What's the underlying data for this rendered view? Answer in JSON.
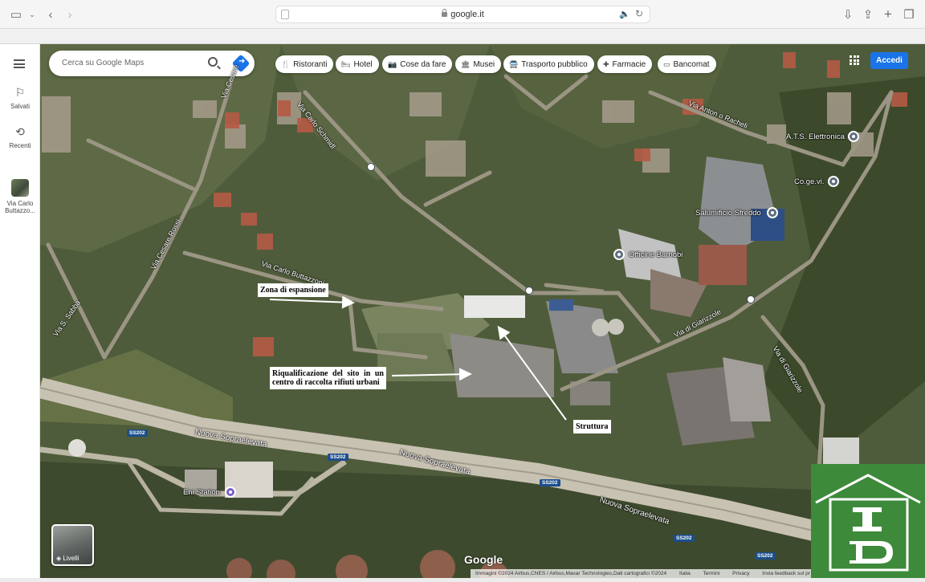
{
  "browser": {
    "url": "google.it"
  },
  "sidebar": {
    "items": [
      {
        "label": "Salvati",
        "icon": "bookmark-icon"
      },
      {
        "label": "Recenti",
        "icon": "history-icon"
      },
      {
        "label": "Via Carlo Buttazzo...",
        "icon": "place-thumbnail"
      }
    ]
  },
  "search": {
    "placeholder": "Cerca su Google Maps"
  },
  "chips": [
    {
      "label": "Ristoranti",
      "icon": "restaurant-icon"
    },
    {
      "label": "Hotel",
      "icon": "hotel-icon"
    },
    {
      "label": "Cose da fare",
      "icon": "camera-icon"
    },
    {
      "label": "Musei",
      "icon": "museum-icon"
    },
    {
      "label": "Trasporto pubblico",
      "icon": "transit-icon"
    },
    {
      "label": "Farmacie",
      "icon": "pharmacy-icon"
    },
    {
      "label": "Bancomat",
      "icon": "atm-icon"
    }
  ],
  "account": {
    "signin_label": "Accedi"
  },
  "map": {
    "roads": [
      "Via Cesare",
      "Via Carlo Schmidl",
      "Via Anton o Racheli",
      "Via Cesare Rossi",
      "Via Carlo Buttazzoni",
      "Via S. Sabba",
      "Via di Giarizzole",
      "Via di Giarizzole",
      "Nuova Sopraelevata",
      "Nuova Sopraelevata",
      "Nuova Sopraelevata"
    ],
    "places": [
      "A.T.S. Elettronica",
      "Co.ge.vi.",
      "Salumificio Sfreddo",
      "Officine Barnobi",
      "Eni Station"
    ],
    "shields": [
      "SS202",
      "SS202",
      "SS202",
      "SS202",
      "SS202"
    ],
    "annotations": {
      "expansion": "Zona di espansione",
      "requalification": "Riqualificazione del sito in un centro di raccolta rifiuti urbani",
      "structure": "Struttura"
    },
    "layers_label": "Livelli",
    "google_logo": "Google",
    "attribution": {
      "imagery": "Immagini ©2024 Airbus,CNES / Airbus,Maxar Technologies,Dati cartografici ©2024",
      "country": "Italia",
      "terms": "Termini",
      "privacy": "Privacy",
      "feedback": "Invia feedback sul pr"
    }
  },
  "watermark": {
    "letters": "ID",
    "color": "#3d8a3a"
  }
}
